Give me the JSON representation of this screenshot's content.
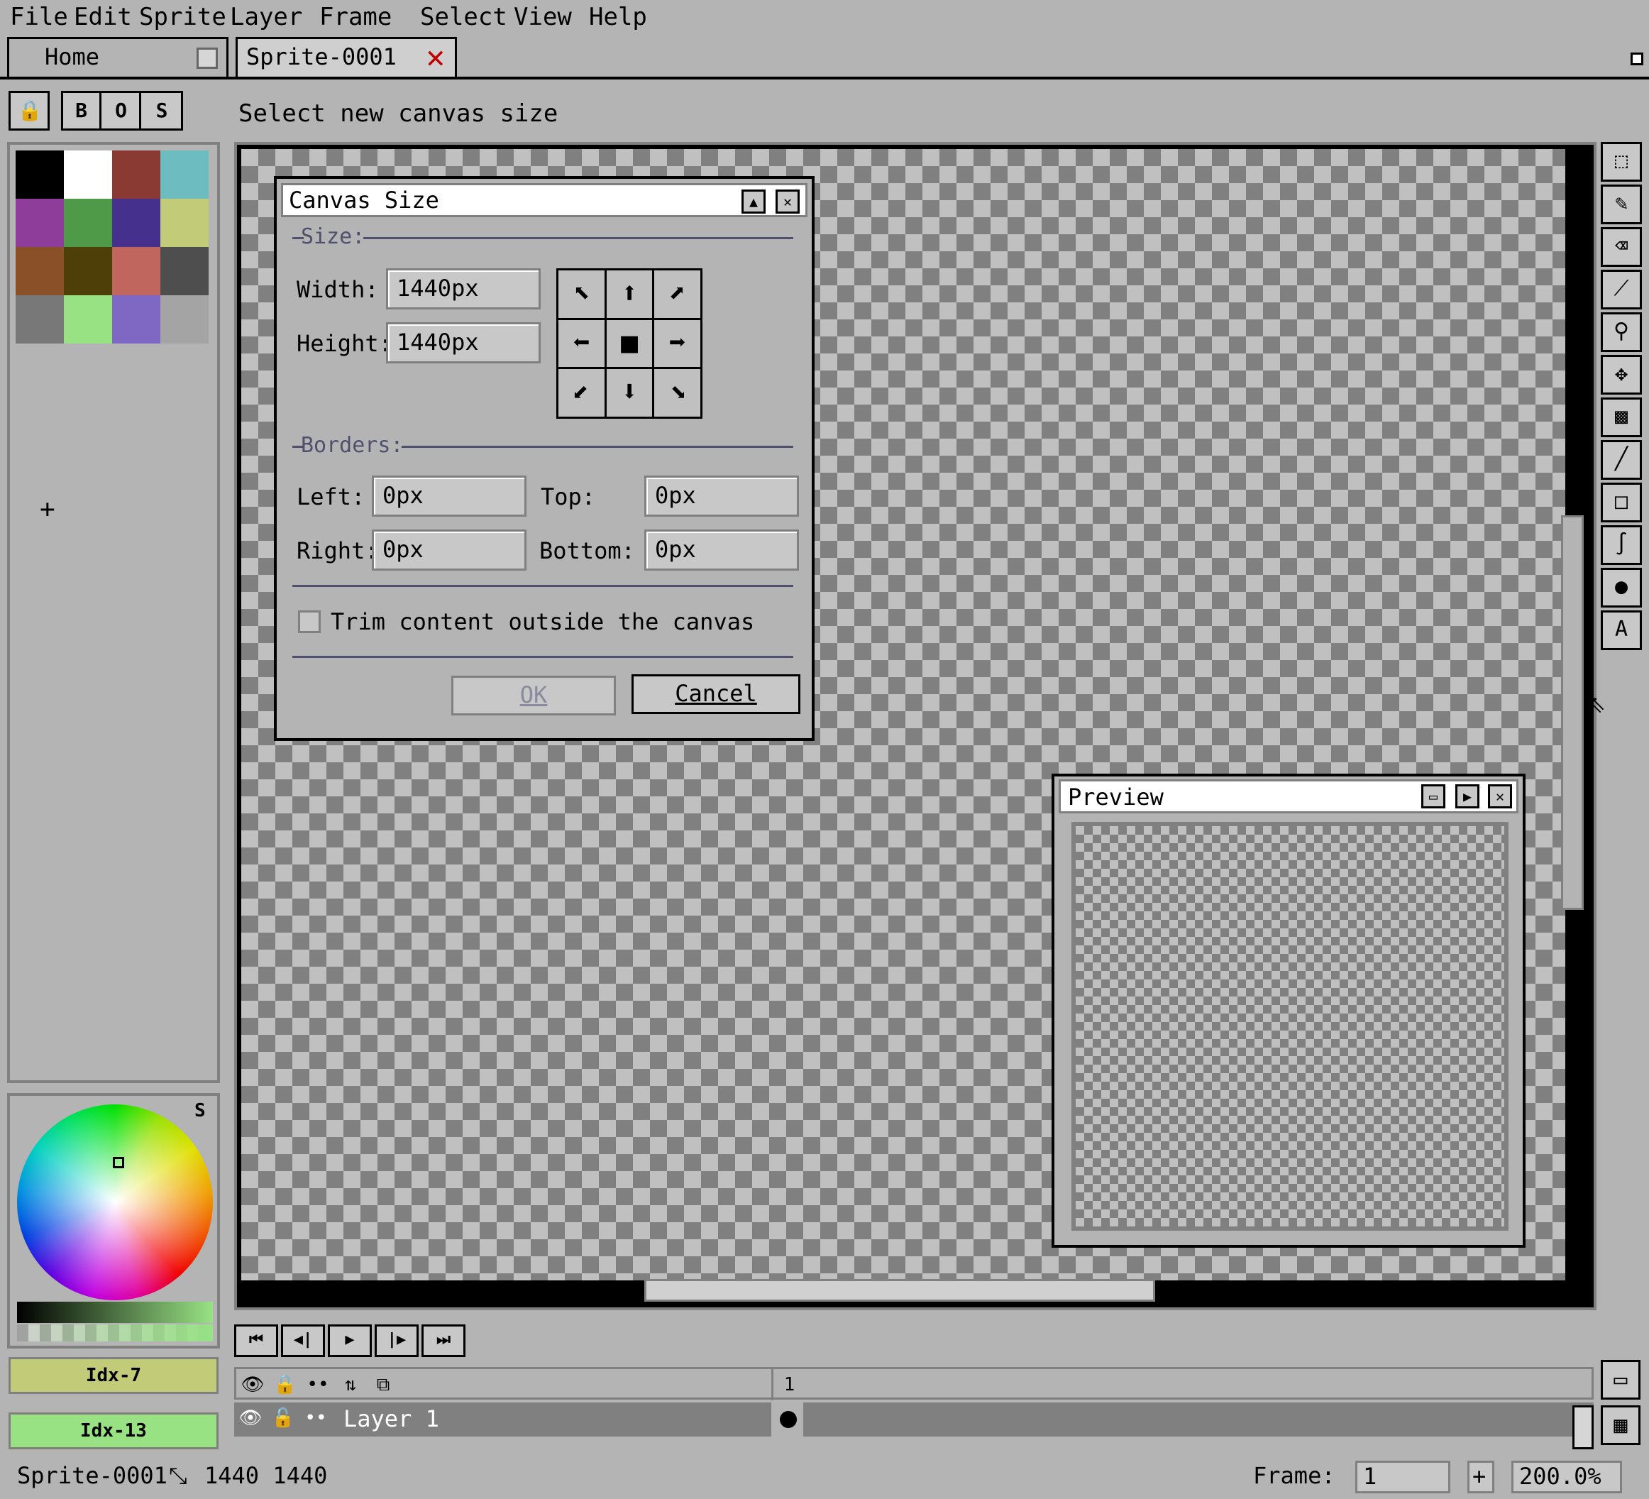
{
  "menu": {
    "file": "File",
    "edit": "Edit",
    "sprite": "Sprite",
    "layer": "Layer",
    "frame": "Frame",
    "select": "Select",
    "view": "View",
    "help": "Help"
  },
  "tabs": {
    "home": "Home",
    "sprite": "Sprite-0001"
  },
  "context_bar": {
    "btn_b": "B",
    "btn_o": "O",
    "btn_s": "S",
    "status": "Select new canvas size"
  },
  "palette": {
    "colors": [
      "#000000",
      "#ffffff",
      "#8a3a32",
      "#6cbcc0",
      "#8e3e9a",
      "#4e9a48",
      "#45308e",
      "#c2cc78",
      "#8a5028",
      "#4e3e08",
      "#c0665e",
      "#4e4e4e",
      "#787878",
      "#98e284",
      "#7e68c4",
      "#a4a4a4"
    ],
    "add": "+"
  },
  "color_wheel": {
    "mode_label": "S"
  },
  "color_bars": {
    "fg": "Idx-7",
    "fg_color": "#c2cc78",
    "bg": "Idx-13",
    "bg_color": "#98e284"
  },
  "dialog": {
    "title": "Canvas Size",
    "size_label": "Size:",
    "width_label": "Width:",
    "width_value": "1440px",
    "height_label": "Height:",
    "height_value": "1440px",
    "borders_label": "Borders:",
    "left_label": "Left:",
    "left_value": "0px",
    "top_label": "Top:",
    "top_value": "0px",
    "right_label": "Right:",
    "right_value": "0px",
    "bottom_label": "Bottom:",
    "bottom_value": "0px",
    "trim_label": "Trim content outside the canvas",
    "ok": "OK",
    "cancel": "Cancel"
  },
  "preview": {
    "title": "Preview"
  },
  "layers": {
    "frame_number": "1",
    "layer_name": "Layer 1"
  },
  "status_bar": {
    "sprite_name": "Sprite-0001",
    "dimensions": "1440 1440",
    "frame_label": "Frame:",
    "frame_value": "1",
    "zoom": "200.0%"
  }
}
